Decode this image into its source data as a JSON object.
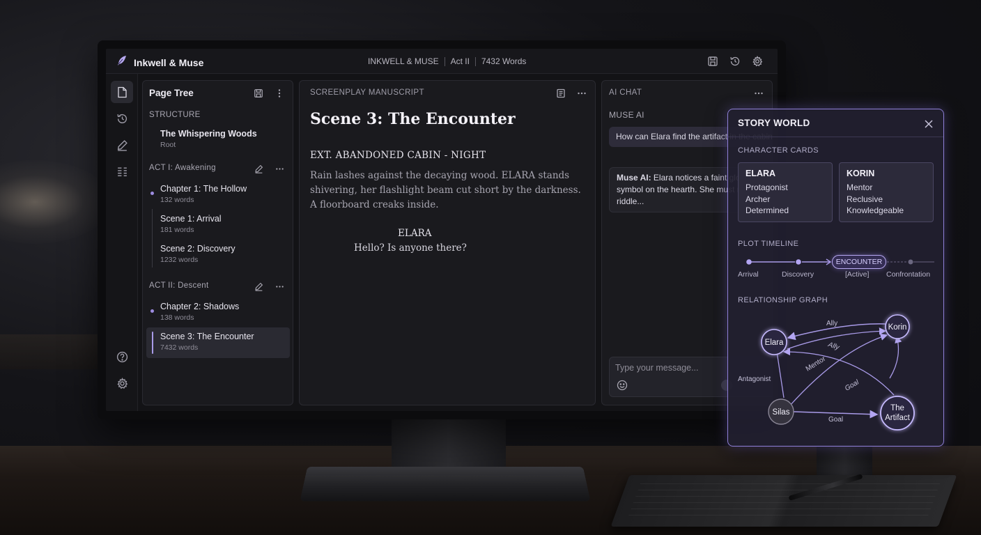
{
  "app": {
    "name": "Inkwell & Muse",
    "meta": {
      "brand": "INKWELL & MUSE",
      "act": "Act II",
      "words": "7432 Words"
    }
  },
  "page_tree": {
    "title": "Page Tree",
    "structure_label": "STRUCTURE",
    "root": {
      "title": "The Whispering Woods",
      "sub": "Root"
    },
    "acts": [
      {
        "label": "ACT I: Awakening",
        "items": [
          {
            "title": "Chapter 1: The Hollow",
            "sub": "132 words"
          },
          {
            "title": "Scene 1: Arrival",
            "sub": "181 words"
          },
          {
            "title": "Scene 2: Discovery",
            "sub": "1232 words"
          }
        ]
      },
      {
        "label": "ACT II: Descent",
        "items": [
          {
            "title": "Chapter 2: Shadows",
            "sub": "138 words"
          },
          {
            "title": "Scene 3: The Encounter",
            "sub": "7432 words"
          }
        ]
      }
    ]
  },
  "manuscript": {
    "header": "SCREENPLAY MANUSCRIPT",
    "scene_title": "Scene 3: The Encounter",
    "slugline": "EXT. ABANDONED CABIN - NIGHT",
    "action": "Rain lashes against the decaying wood. ELARA stands shivering, her flashlight beam cut short by the darkness. A floorboard creaks inside.",
    "character": "ELARA",
    "dialogue": "Hello? Is anyone there?"
  },
  "chat": {
    "header": "AI CHAT",
    "assistant_name": "MUSE AI",
    "user_message": "How can Elara find the artifact in the cabin?",
    "ai_prefix": "Muse AI:",
    "ai_message": " Elara notices a faint glowing faint symbol on the hearth. She must recall the riddle...",
    "input_placeholder": "Type your message..."
  },
  "story_world": {
    "title": "STORY WORLD",
    "character_cards_label": "CHARACTER CARDS",
    "cards": [
      {
        "name": "ELARA",
        "traits": [
          "Protagonist",
          "Archer",
          "Determined"
        ]
      },
      {
        "name": "KORIN",
        "traits": [
          "Mentor",
          "Reclusive",
          "Knowledgeable"
        ]
      }
    ],
    "plot_timeline_label": "PLOT TIMELINE",
    "timeline": {
      "points": [
        "Arrival",
        "Discovery",
        "ENCOUNTER",
        "Confrontation"
      ],
      "active_label": "[Active]"
    },
    "relationship_label": "RELATIONSHIP GRAPH",
    "graph": {
      "nodes": [
        "Elara",
        "Korin",
        "Silas",
        "The",
        "Artifact"
      ],
      "edges": [
        "Ally",
        "Ally",
        "Mentor",
        "Goal",
        "Antagonist",
        "Goal"
      ]
    }
  },
  "colors": {
    "accent": "#a99be8",
    "accent_glow": "#8f80d8",
    "panel_bg": "#1a1a1e"
  }
}
